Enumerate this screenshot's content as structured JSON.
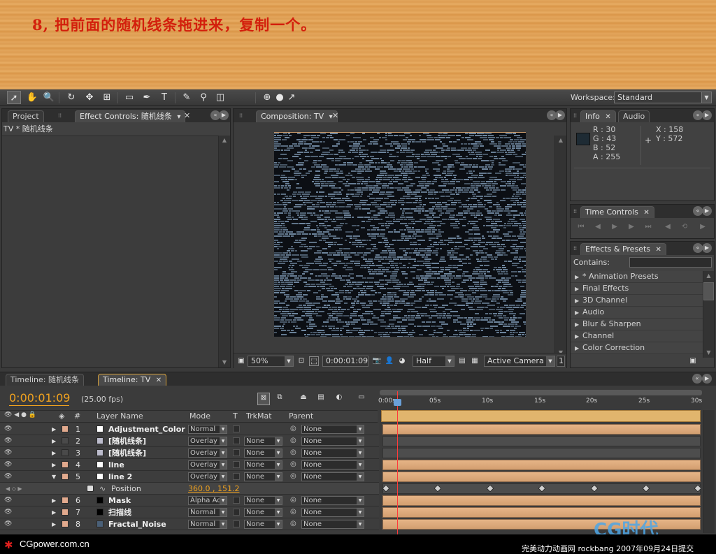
{
  "banner": {
    "title": "8, 把前面的随机线条拖进来，复制一个。"
  },
  "toolbar": {
    "tools": [
      "selection-tool",
      "hand-tool",
      "zoom-tool",
      "rotate-tool",
      "orbit-camera-tool",
      "pan-behind-tool",
      "rectangle-tool",
      "pen-tool",
      "type-tool",
      "brush-tool",
      "clone-stamp-tool",
      "eraser-tool",
      "axis-local-tool",
      "axis-world-tool",
      "axis-view-tool"
    ],
    "workspace_label": "Workspace:",
    "workspace_value": "Standard"
  },
  "left_panel": {
    "tabs": [
      "Project",
      "Effect Controls: 随机线条"
    ],
    "subtitle": "TV * 随机线条"
  },
  "comp_panel": {
    "tab": "Composition: TV",
    "zoom": "50%",
    "timecode": "0:00:01:09",
    "resolution": "Half",
    "camera": "Active Camera",
    "views": "1"
  },
  "info_panel": {
    "tabs": [
      "Info",
      "Audio"
    ],
    "swatch_color": "#1e2b34",
    "r": "R : 30",
    "g": "G : 43",
    "b": "B : 52",
    "a": "A : 255",
    "x": "X : 158",
    "y": "Y : 572"
  },
  "time_panel": {
    "tab": "Time Controls"
  },
  "effects_panel": {
    "tab": "Effects & Presets",
    "contains_label": "Contains:",
    "items": [
      "* Animation Presets",
      "Final Effects",
      "3D Channel",
      "Audio",
      "Blur & Sharpen",
      "Channel",
      "Color Correction"
    ]
  },
  "timeline": {
    "tabs": [
      "Timeline: 随机线条",
      "Timeline: TV"
    ],
    "timecode": "0:00:01:09",
    "fps": "(25.00 fps)",
    "headers": {
      "num": "#",
      "layer_name": "Layer Name",
      "mode": "Mode",
      "t": "T",
      "trkmat": "TrkMat",
      "parent": "Parent"
    },
    "ruler": [
      "0:00s",
      "05s",
      "10s",
      "15s",
      "20s",
      "25s",
      "30s"
    ],
    "layers": [
      {
        "num": "1",
        "name": "Adjustment_Color",
        "mode": "Normal",
        "trkmat": "",
        "parent": "None",
        "label": "#e1a98d",
        "swatch": "#ffffff",
        "expanded": false
      },
      {
        "num": "2",
        "name": "[随机线条]",
        "mode": "Overlay",
        "trkmat": "None",
        "parent": "None",
        "label": "#4a4a4a",
        "swatch": "#bcbccc",
        "expanded": false
      },
      {
        "num": "3",
        "name": "[随机线条]",
        "mode": "Overlay",
        "trkmat": "None",
        "parent": "None",
        "label": "#4a4a4a",
        "swatch": "#bcbccc",
        "expanded": false
      },
      {
        "num": "4",
        "name": "line",
        "mode": "Overlay",
        "trkmat": "None",
        "parent": "None",
        "label": "#e1a98d",
        "swatch": "#ffffff",
        "expanded": false
      },
      {
        "num": "5",
        "name": "line 2",
        "mode": "Overlay",
        "trkmat": "None",
        "parent": "None",
        "label": "#e1a98d",
        "swatch": "#ffffff",
        "expanded": true
      },
      {
        "num": "6",
        "name": "Mask",
        "mode": "Alpha Ad",
        "trkmat": "None",
        "parent": "None",
        "label": "#e1a98d",
        "swatch": "#000000",
        "expanded": false
      },
      {
        "num": "7",
        "name": "扫描线",
        "mode": "Normal",
        "trkmat": "None",
        "parent": "None",
        "label": "#e1a98d",
        "swatch": "#000000",
        "expanded": false
      },
      {
        "num": "8",
        "name": "Fractal_Noise",
        "mode": "Normal",
        "trkmat": "None",
        "parent": "None",
        "label": "#e1a98d",
        "swatch": "#4a6078",
        "expanded": false
      }
    ],
    "property": {
      "name": "Position",
      "value": "360.0 , 151.2"
    }
  },
  "footer": {
    "left": "CGpower.com.cn",
    "right": "完美动力动画网 rockbang 2007年09月24日提交",
    "logo": "CG时代"
  }
}
